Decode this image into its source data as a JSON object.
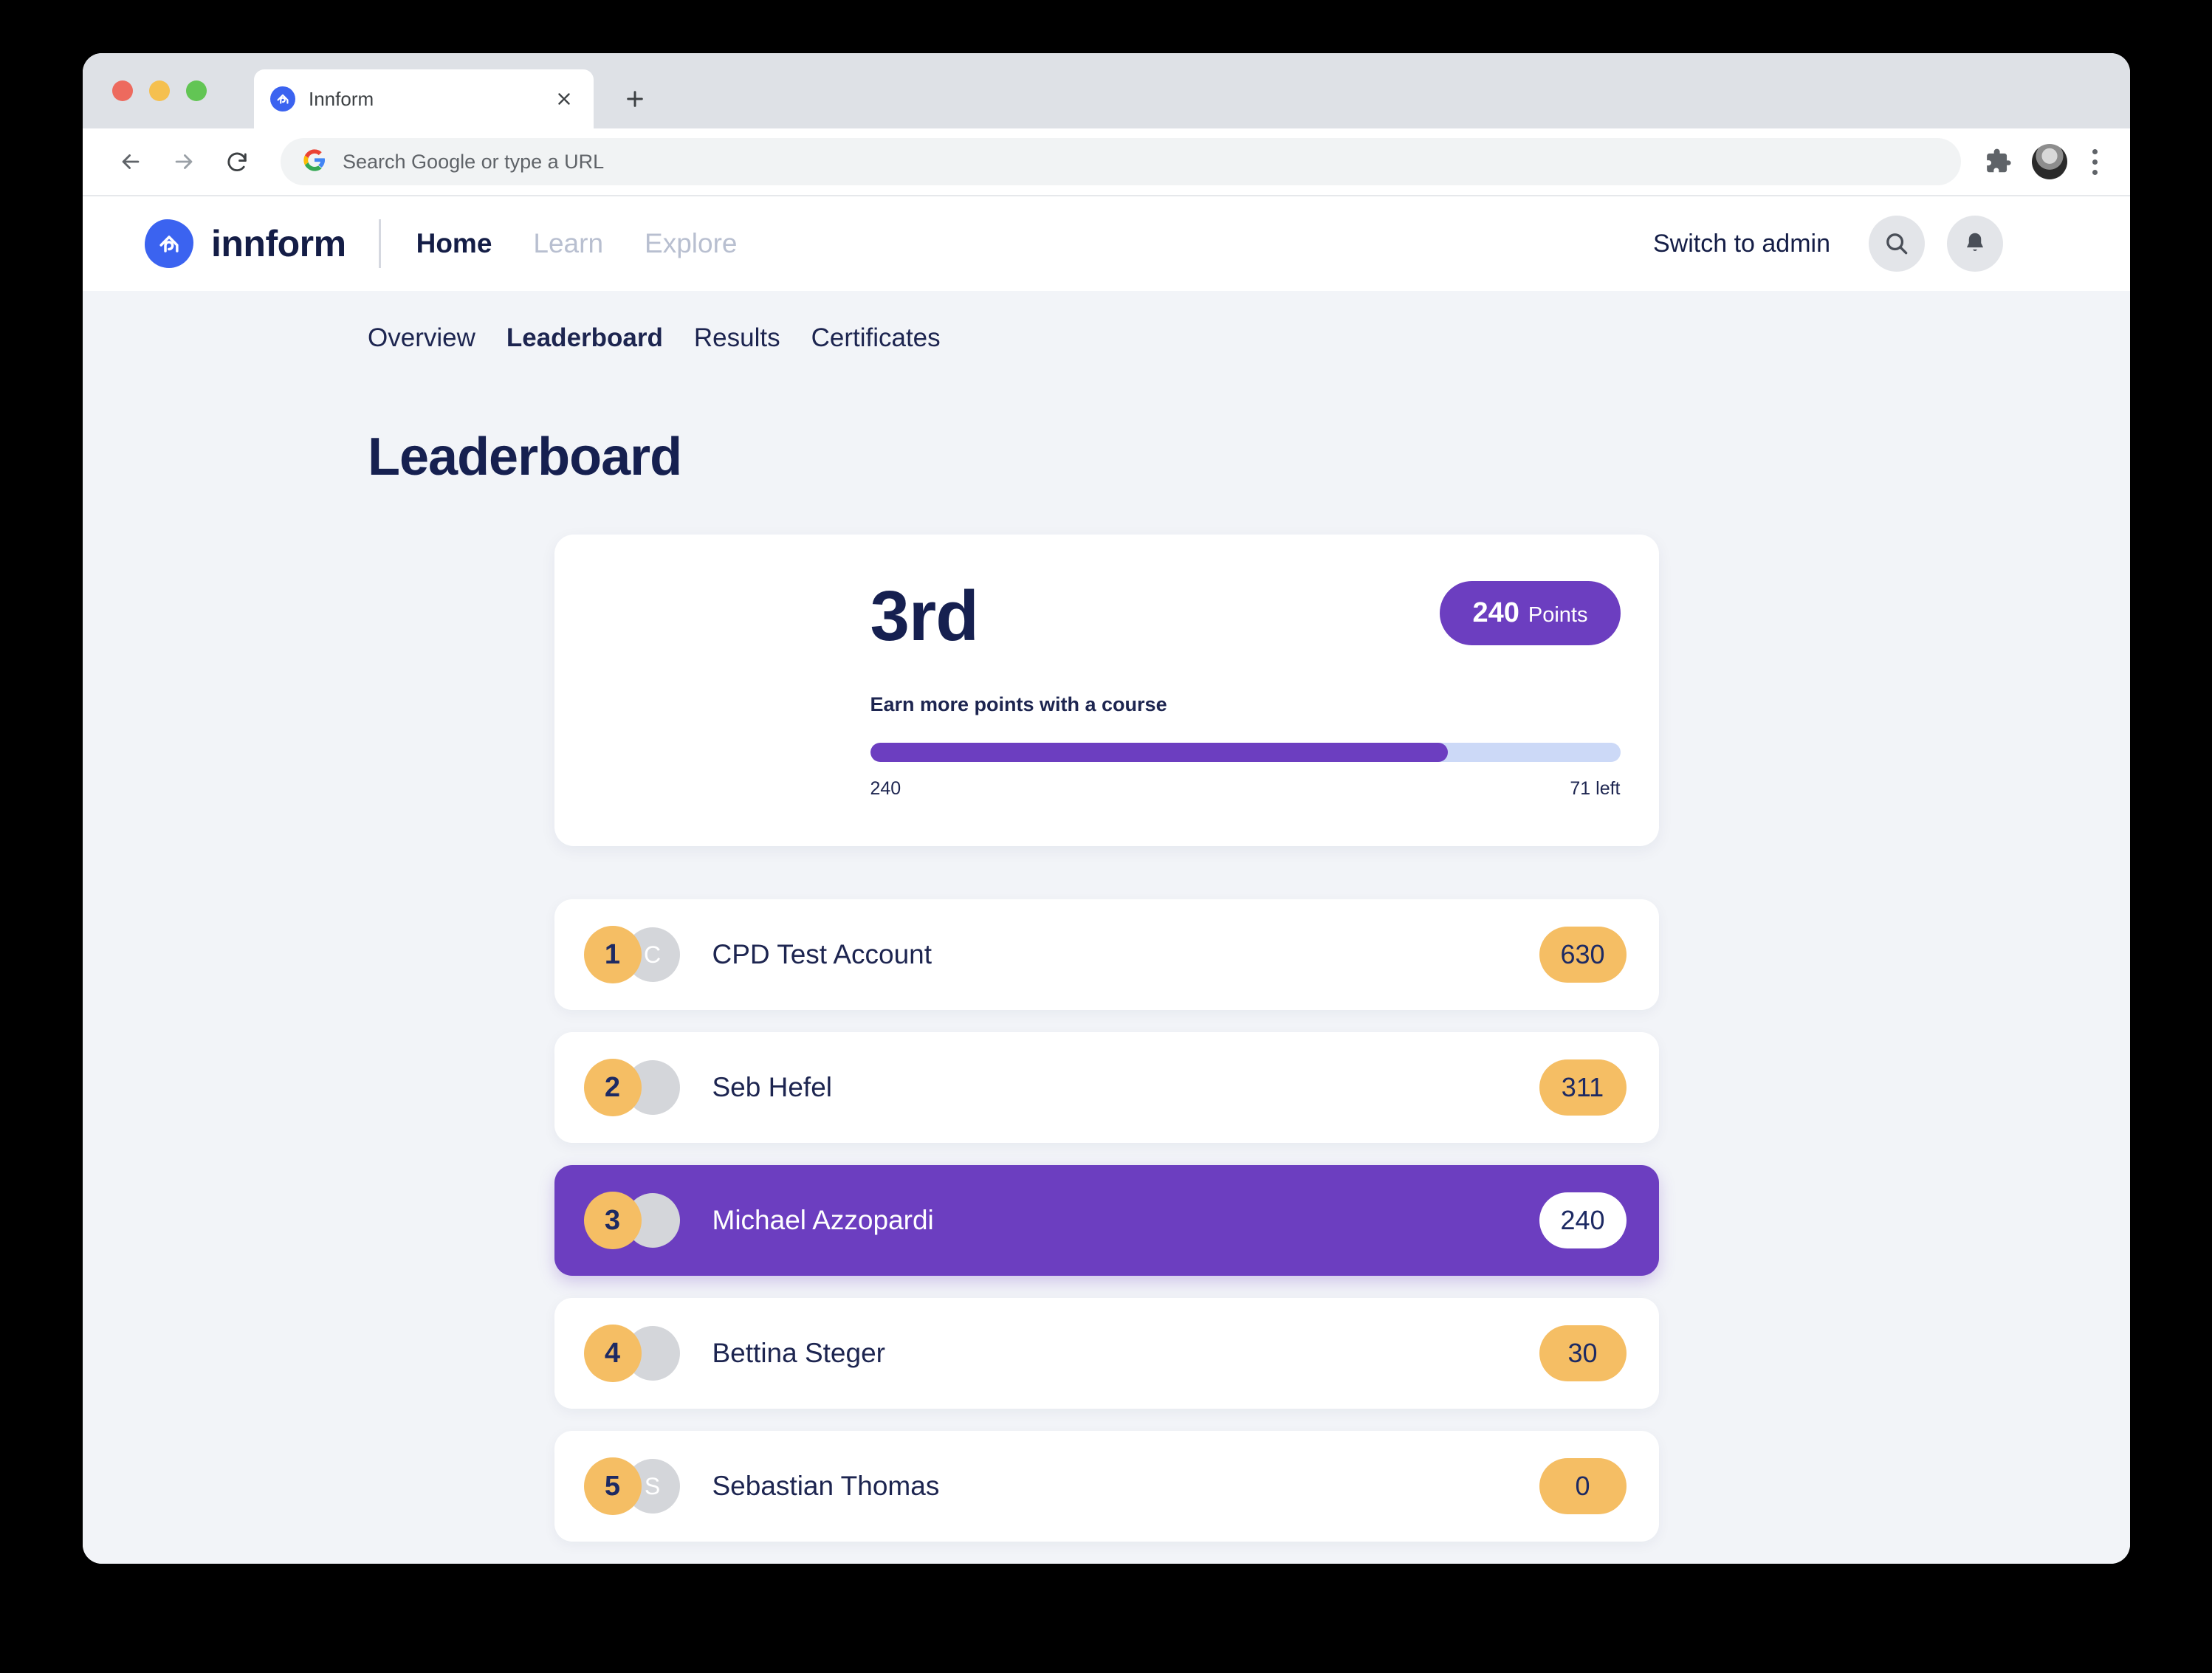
{
  "browser": {
    "tab_title": "Innform",
    "tab_favicon_icon": "innform-logo-icon",
    "close_icon": "close-icon",
    "new_tab_icon": "plus-icon",
    "back_icon": "back-arrow-icon",
    "forward_icon": "forward-arrow-icon",
    "reload_icon": "reload-icon",
    "omnibox_placeholder": "Search Google or type a URL",
    "omnibox_value": "",
    "google_icon": "google-g-icon",
    "extensions_icon": "puzzle-piece-icon",
    "profile_icon": "browser-profile-avatar",
    "menu_icon": "three-dot-menu-icon"
  },
  "app_header": {
    "brand_name": "innform",
    "brand_icon": "innform-house-logo-icon",
    "nav": [
      {
        "label": "Home",
        "active": true
      },
      {
        "label": "Learn",
        "active": false
      },
      {
        "label": "Explore",
        "active": false
      }
    ],
    "switch_to_admin": "Switch to admin",
    "search_icon": "search-icon",
    "notification_icon": "bell-icon",
    "avatar_icon": "user-avatar"
  },
  "sub_nav": [
    {
      "label": "Overview",
      "active": false
    },
    {
      "label": "Leaderboard",
      "active": true
    },
    {
      "label": "Results",
      "active": false
    },
    {
      "label": "Certificates",
      "active": false
    }
  ],
  "page": {
    "title": "Leaderboard"
  },
  "hero": {
    "avatar_icon": "current-user-avatar",
    "rank": "3rd",
    "points_value": "240",
    "points_label": "Points",
    "progress_caption": "Earn more points with a course",
    "progress_current": "240",
    "progress_remaining": "71 left",
    "progress_percent": 77
  },
  "leaderboard": {
    "rows": [
      {
        "rank": "1",
        "name": "CPD Test Account",
        "score": "630",
        "avatar_kind": "initial",
        "initial": "C",
        "highlight": false
      },
      {
        "rank": "2",
        "name": "Seb Hefel",
        "score": "311",
        "avatar_kind": "photo-seb",
        "initial": "",
        "highlight": false
      },
      {
        "rank": "3",
        "name": "Michael Azzopardi",
        "score": "240",
        "avatar_kind": "photo-mike",
        "initial": "",
        "highlight": true
      },
      {
        "rank": "4",
        "name": "Bettina Steger",
        "score": "30",
        "avatar_kind": "photo-bettina",
        "initial": "",
        "highlight": false
      },
      {
        "rank": "5",
        "name": "Sebastian Thomas",
        "score": "0",
        "avatar_kind": "initial",
        "initial": "S",
        "highlight": false
      }
    ]
  },
  "colors": {
    "brand_blue": "#3b63f0",
    "accent_purple": "#6c3ec0",
    "gold": "#f5be64",
    "navy": "#162050",
    "page_bg": "#f2f4f8",
    "muted_nav": "#b8bfd0"
  }
}
